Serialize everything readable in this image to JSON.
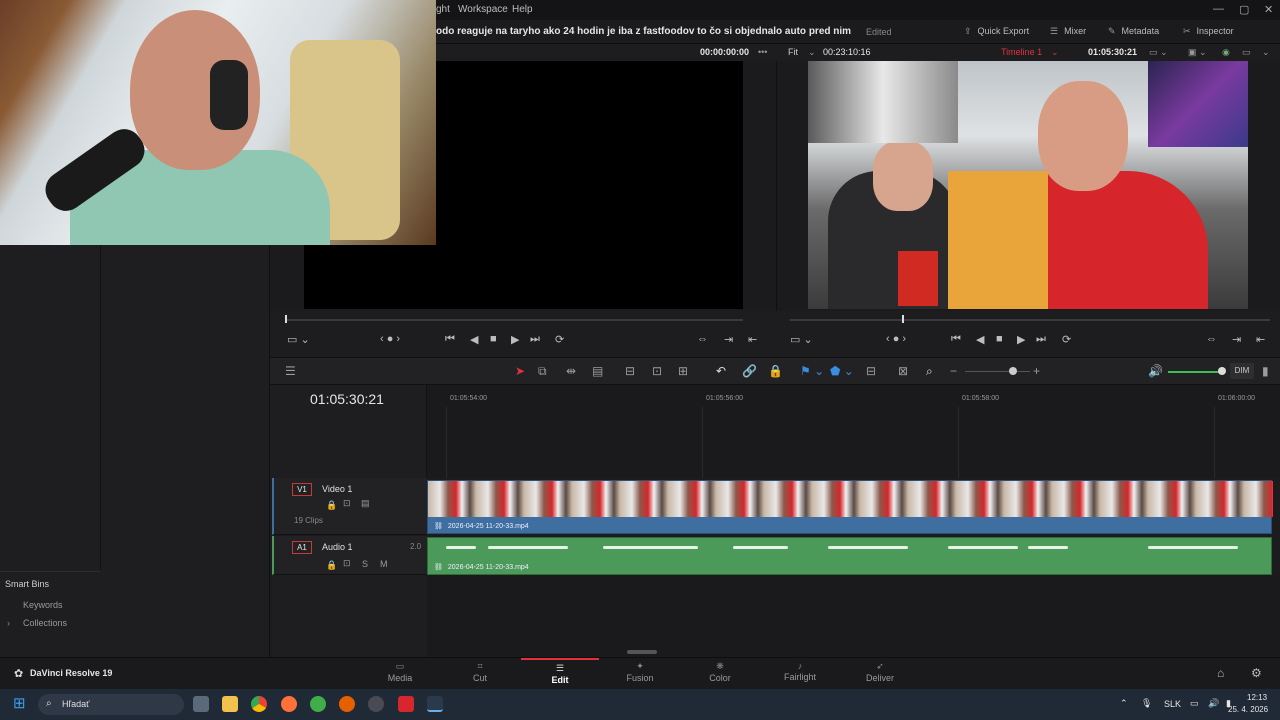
{
  "menu": {
    "items": [
      "ght",
      "Workspace",
      "Help"
    ]
  },
  "titlebar": {
    "project_title": "odo reaguje na taryho ako 24 hodin je iba z fastfoodov to čo si objednalo auto pred nim",
    "edited": "Edited",
    "buttons": [
      "Quick Export",
      "Mixer",
      "Metadata",
      "Inspector"
    ]
  },
  "viewer": {
    "source_timecode": "00:00:00:00",
    "fit_label": "Fit",
    "duration": "00:23:10:16",
    "timeline_name": "Timeline 1",
    "program_timecode": "01:05:30:21"
  },
  "timeline": {
    "current_timecode": "01:05:30:21",
    "ruler_ticks": [
      "01:05:54:00",
      "01:05:56:00",
      "01:05:58:00",
      "01:06:00:00"
    ],
    "tracks": [
      {
        "tag": "V1",
        "name": "Video 1",
        "clip_count": "19 Clips",
        "clip_name": "2026-04-25 11-20-33.mp4"
      },
      {
        "tag": "A1",
        "name": "Audio 1",
        "channels": "2.0",
        "clip_name": "2026-04-25 11-20-33.mp4"
      }
    ],
    "audio_buttons": [
      "S",
      "M"
    ],
    "dim_label": "DIM"
  },
  "smart_bins": {
    "header": "Smart Bins",
    "items": [
      "Keywords",
      "Collections"
    ]
  },
  "app": {
    "brand": "DaVinci Resolve 19"
  },
  "pages": [
    {
      "label": "Media",
      "icon": "media-icon"
    },
    {
      "label": "Cut",
      "icon": "cut-icon"
    },
    {
      "label": "Edit",
      "icon": "edit-icon",
      "active": true
    },
    {
      "label": "Fusion",
      "icon": "fusion-icon"
    },
    {
      "label": "Color",
      "icon": "color-icon"
    },
    {
      "label": "Fairlight",
      "icon": "fairlight-icon"
    },
    {
      "label": "Deliver",
      "icon": "deliver-icon"
    }
  ],
  "taskbar": {
    "search_placeholder": "Hľadať",
    "language": "SLK",
    "time": "12:13",
    "date": "25. 4. 2026"
  },
  "colors": {
    "accent_red": "#e0323c",
    "video_clip": "#3f6fa0",
    "audio_clip": "#4b9a5a",
    "taskbar": "#202a36"
  }
}
